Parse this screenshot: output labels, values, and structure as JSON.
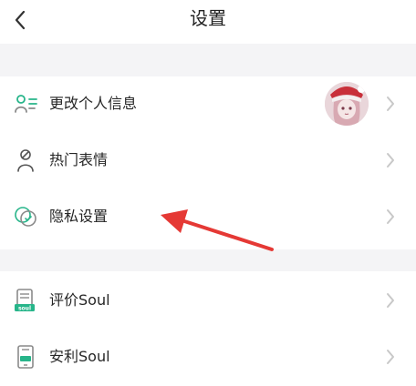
{
  "header": {
    "title": "设置",
    "back_icon": "chevron-left-icon"
  },
  "group1": [
    {
      "label": "更改个人信息",
      "icon": "person-list-icon",
      "has_avatar": true
    },
    {
      "label": "热门表情",
      "icon": "person-prohibited-icon"
    },
    {
      "label": "隐私设置",
      "icon": "privacy-shield-icon"
    }
  ],
  "group2": [
    {
      "label": "评价Soul",
      "icon": "soul-rate-icon"
    },
    {
      "label": "安利Soul",
      "icon": "soul-recommend-icon"
    }
  ],
  "annotation": {
    "type": "red-arrow",
    "color": "#e53935",
    "points_to": "隐私设置"
  },
  "colors": {
    "icon_green": "#27b58a",
    "chevron": "#c8c8c8",
    "section_gap": "#f4f4f6"
  }
}
